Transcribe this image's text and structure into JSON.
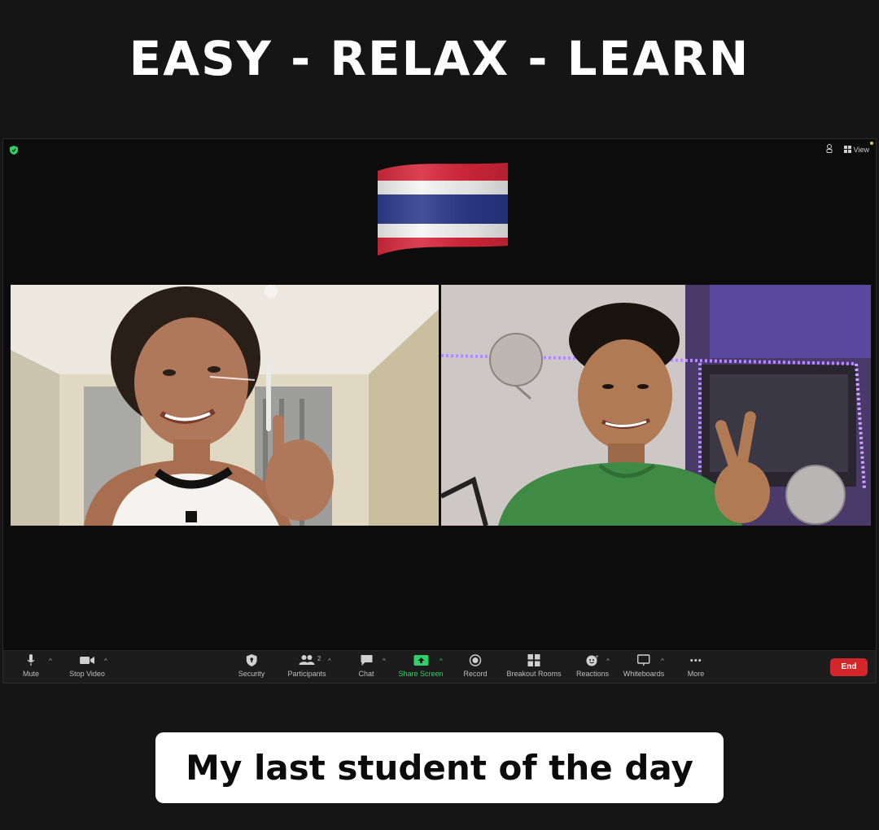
{
  "headline": "EASY - RELAX - LEARN",
  "caption": "My last student of the day",
  "meeting": {
    "view_label": "View",
    "flag_icon": "thailand-flag-icon",
    "participants": [
      {
        "icon": "video-feed-woman-icon"
      },
      {
        "icon": "video-feed-man-icon"
      }
    ]
  },
  "toolbar": {
    "mute": "Mute",
    "stop_video": "Stop Video",
    "security": "Security",
    "participants": "Participants",
    "participants_count": "2",
    "chat": "Chat",
    "share_screen": "Share Screen",
    "record": "Record",
    "breakout_rooms": "Breakout Rooms",
    "reactions": "Reactions",
    "whiteboards": "Whiteboards",
    "more": "More",
    "end": "End"
  },
  "colors": {
    "background": "#151515",
    "toolbar": "#1c1c1c",
    "share_green": "#2fcf6a",
    "end_red": "#d3262a",
    "led_purple": "#8a4cff"
  }
}
